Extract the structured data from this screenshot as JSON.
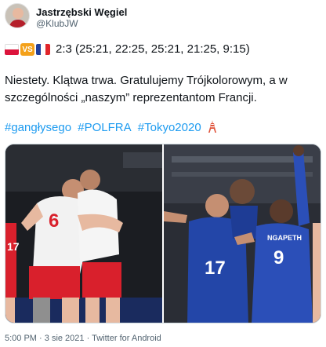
{
  "author": {
    "name": "Jastrzębski Węgiel",
    "handle": "@KlubJW"
  },
  "match": {
    "vs_label": "VS",
    "score": "2:3 (25:21, 22:25, 25:21, 21:25, 9:15)"
  },
  "tweet": {
    "text": "Niestety. Klątwa trwa. Gratulujemy Trójkolorowym, a w szczególności „naszym” reprezentantom Francji.",
    "hashtags": [
      "#gangłysego",
      "#POLFRA",
      "#Tokyo2020"
    ]
  },
  "media": {
    "left_photo_jersey_numbers": [
      "6",
      "17"
    ],
    "right_photo_jersey_numbers": [
      "17",
      "9"
    ],
    "right_photo_name_on_shirt": "NGAPETH"
  },
  "meta": {
    "time": "5:00 PM",
    "date": "3 sie 2021",
    "source": "Twitter for Android",
    "separator": "·"
  },
  "colors": {
    "link": "#1d9bf0",
    "poland_red": "#dc143c",
    "france_blue": "#1f3f9c",
    "vs_orange": "#f4a11a"
  }
}
